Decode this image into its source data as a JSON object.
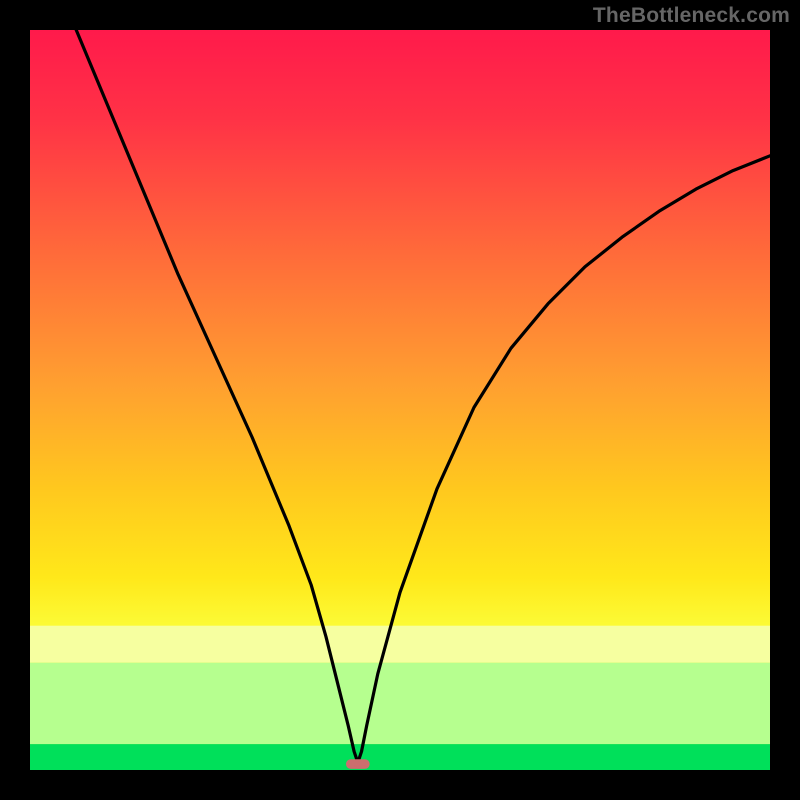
{
  "watermark": "TheBottleneck.com",
  "axes": {
    "x_label": "",
    "y_label": ""
  },
  "colors": {
    "frame_bg": "#000000",
    "curve": "#000000",
    "gradient_top": "#ff1a4b",
    "gradient_mid": "#ffd400",
    "band_light_yellow": "#f6ffa0",
    "band_pale_green": "#b6ff8f",
    "band_green": "#00e05a",
    "marker": "#cc6e6e"
  },
  "chart_data": {
    "type": "line",
    "title": "",
    "xlabel": "",
    "ylabel": "",
    "xlim": [
      0,
      100
    ],
    "ylim": [
      0,
      100
    ],
    "series": [
      {
        "name": "bottleneck-curve",
        "x": [
          0,
          5,
          10,
          15,
          20,
          25,
          30,
          35,
          38,
          40,
          41.5,
          43,
          43.8,
          44.3,
          44.8,
          45.5,
          47,
          50,
          55,
          60,
          65,
          70,
          75,
          80,
          85,
          90,
          95,
          100
        ],
        "y": [
          115,
          103,
          91,
          79,
          67,
          56,
          45,
          33,
          25,
          18,
          12,
          6,
          2.5,
          1.0,
          2.5,
          6,
          13,
          24,
          38,
          49,
          57,
          63,
          68,
          72,
          75.5,
          78.5,
          81,
          83
        ]
      }
    ],
    "marker": {
      "x": 44.3,
      "y": 0.8,
      "width": 3.2,
      "height": 1.3
    },
    "bands": [
      {
        "name": "light-yellow",
        "y0": 14.5,
        "y1": 19.5,
        "color": "#f6ffa0"
      },
      {
        "name": "pale-green",
        "y0": 3.5,
        "y1": 14.5,
        "color": "#b6ff8f"
      },
      {
        "name": "green",
        "y0": 0.0,
        "y1": 3.5,
        "color": "#00e05a"
      }
    ]
  }
}
